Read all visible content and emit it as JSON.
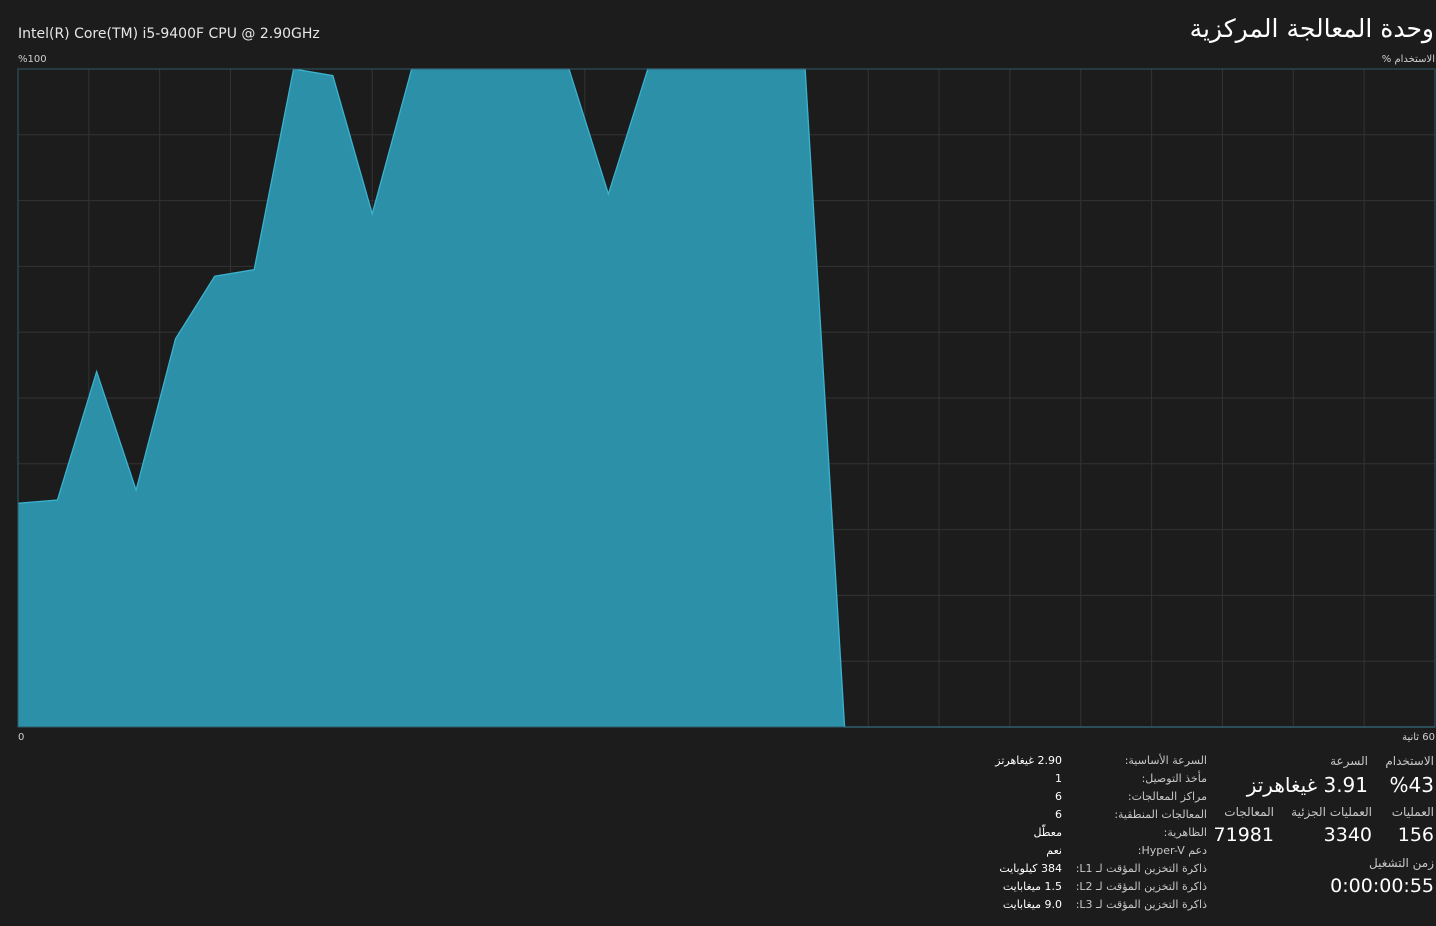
{
  "header": {
    "title": "وحدة المعالجة المركزية",
    "cpu_model": "Intel(R) Core(TM) i5-9400F CPU @ 2.90GHz"
  },
  "graph": {
    "y_axis_label": "الاستخدام %",
    "y_max_label": "%100",
    "x_min_label": "0",
    "x_max_label": "60 ثانية",
    "fill_color": "#2b90a8",
    "line_color": "#3ab3d0",
    "grid_color": "#333333"
  },
  "chart_data": {
    "type": "area",
    "x": [
      60,
      58.33,
      56.67,
      55,
      53.33,
      51.67,
      50,
      48.33,
      46.67,
      45,
      43.33,
      41.67,
      40,
      38.33,
      36.67,
      35,
      33.33,
      31.67,
      30,
      28.33,
      26.67,
      25,
      0
    ],
    "values": [
      34,
      34.5,
      54,
      36,
      59,
      68.5,
      69.5,
      100,
      99,
      78,
      100,
      100,
      100,
      100,
      100,
      81,
      100,
      100,
      100,
      100,
      100,
      0,
      0
    ],
    "xlim": [
      60,
      0
    ],
    "ylim": [
      0,
      100
    ],
    "grid": true
  },
  "stats": {
    "usage": {
      "label": "الاستخدام",
      "value": "%43"
    },
    "speed": {
      "label": "السرعة",
      "value": "3.91 غيغاهرتز"
    },
    "processes": {
      "label": "العمليات",
      "value": "156"
    },
    "threads": {
      "label": "العمليات الجزئية",
      "value": "3340"
    },
    "handles": {
      "label": "المعالجات",
      "value": "71981"
    },
    "uptime": {
      "label": "زمن التشغيل",
      "value": "0:00:00:55"
    }
  },
  "details": [
    {
      "label": "السرعة الأساسية:",
      "value": "2.90 غيغاهرتز"
    },
    {
      "label": "مأخذ التوصيل:",
      "value": "1"
    },
    {
      "label": "مراكز المعالجات:",
      "value": "6"
    },
    {
      "label": "المعالجات المنطقية:",
      "value": "6"
    },
    {
      "label": "الظاهرية:",
      "value": "معطّل"
    },
    {
      "label": "دعم Hyper-V:",
      "value": "نعم"
    },
    {
      "label": "ذاكرة التخزين المؤقت لـ L1:",
      "value": "384 كيلوبايت"
    },
    {
      "label": "ذاكرة التخزين المؤقت لـ L2:",
      "value": "1.5 ميغابايت"
    },
    {
      "label": "ذاكرة التخزين المؤقت لـ L3:",
      "value": "9.0 ميغابايت"
    }
  ]
}
